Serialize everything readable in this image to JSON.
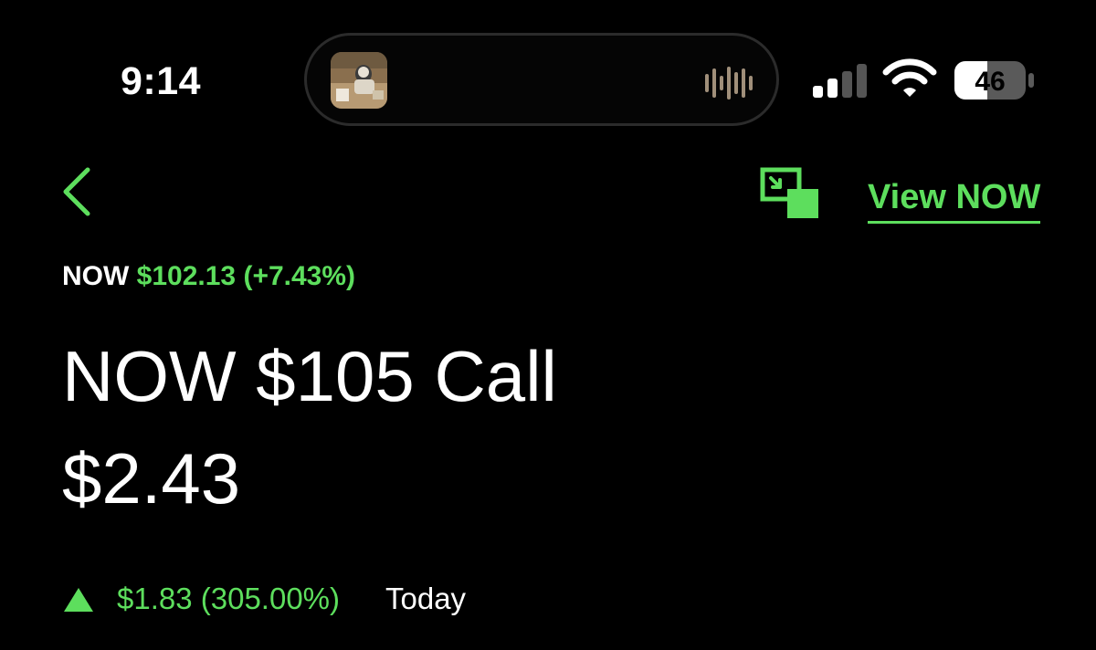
{
  "status_bar": {
    "time": "9:14",
    "battery_level": "46",
    "icons": [
      "album-art",
      "waveform-icon",
      "cell-signal-icon",
      "wifi-icon",
      "battery-icon"
    ]
  },
  "header": {
    "back_icon": "chevron-left-icon",
    "pip_icon": "picture-in-picture-icon",
    "view_link_label": "View NOW"
  },
  "quote": {
    "ticker": "NOW",
    "price_change": "$102.13 (+7.43%)"
  },
  "option": {
    "title": "NOW $105 Call",
    "price": "$2.43",
    "change": "$1.83 (305.00%)",
    "change_direction": "up",
    "period": "Today"
  },
  "colors": {
    "accent_green": "#5dde5d",
    "background": "#000000",
    "text": "#ffffff"
  }
}
